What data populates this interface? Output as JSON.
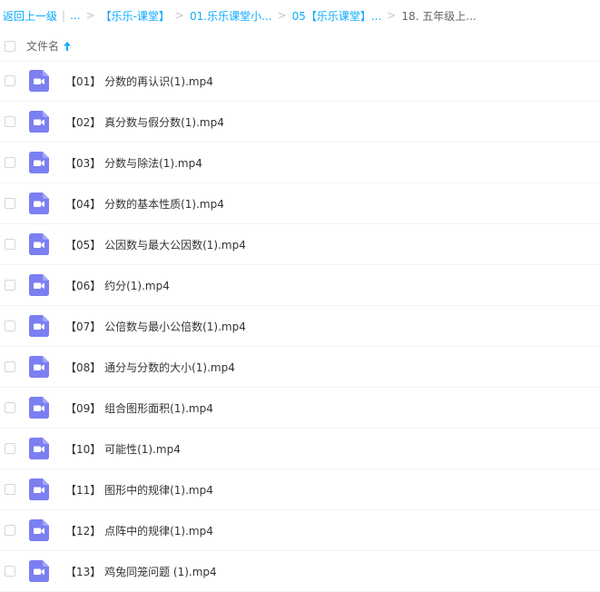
{
  "breadcrumb": {
    "back_label": "返回上一级",
    "pipe": "|",
    "ellipsis": "...",
    "sep": ">",
    "crumb1": "【乐乐-课堂】",
    "crumb2": "01.乐乐课堂小...",
    "crumb3": "05【乐乐课堂】...",
    "current": "18. 五年级上..."
  },
  "header": {
    "column_label": "文件名",
    "sort": "ascending",
    "sort_icon": "arrow-up-icon"
  },
  "colors": {
    "link": "#09aaff",
    "video_icon": "#7b7ff1",
    "text": "#333333"
  },
  "files": [
    {
      "name": "【01】 分数的再认识(1).mp4",
      "icon": "video-file-icon"
    },
    {
      "name": "【02】 真分数与假分数(1).mp4",
      "icon": "video-file-icon"
    },
    {
      "name": "【03】 分数与除法(1).mp4",
      "icon": "video-file-icon"
    },
    {
      "name": "【04】 分数的基本性质(1).mp4",
      "icon": "video-file-icon"
    },
    {
      "name": "【05】 公因数与最大公因数(1).mp4",
      "icon": "video-file-icon"
    },
    {
      "name": "【06】 约分(1).mp4",
      "icon": "video-file-icon"
    },
    {
      "name": "【07】 公倍数与最小公倍数(1).mp4",
      "icon": "video-file-icon"
    },
    {
      "name": "【08】 通分与分数的大小(1).mp4",
      "icon": "video-file-icon"
    },
    {
      "name": "【09】 组合图形面积(1).mp4",
      "icon": "video-file-icon"
    },
    {
      "name": "【10】 可能性(1).mp4",
      "icon": "video-file-icon"
    },
    {
      "name": "【11】 图形中的规律(1).mp4",
      "icon": "video-file-icon"
    },
    {
      "name": "【12】 点阵中的规律(1).mp4",
      "icon": "video-file-icon"
    },
    {
      "name": "【13】 鸡兔同笼问题 (1).mp4",
      "icon": "video-file-icon"
    }
  ]
}
